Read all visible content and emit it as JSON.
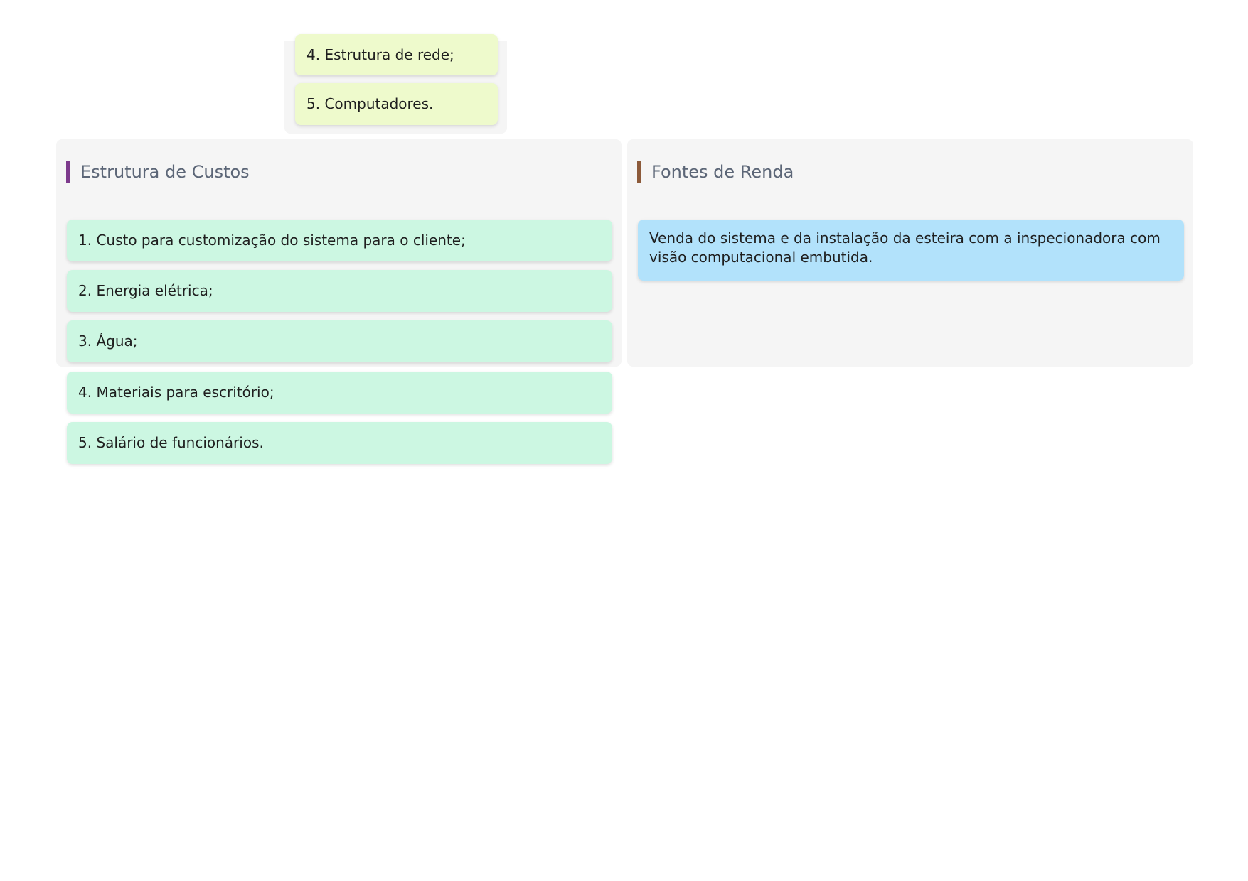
{
  "top_block": {
    "items": [
      "4. Estrutura de rede;",
      "5. Computadores."
    ]
  },
  "costs": {
    "title": "Estrutura de Custos",
    "accent_color": "#7d3a8c",
    "items": [
      "1. Custo para customização do sistema para o cliente;",
      "2. Energia elétrica;",
      "3. Água;",
      "4. Materiais para escritório;",
      "5. Salário de funcionários."
    ]
  },
  "revenue": {
    "title": "Fontes de Renda",
    "accent_color": "#8c5a3a",
    "items": [
      "Venda do sistema e da instalação da esteira com a inspecionadora com visão computacional embutida."
    ]
  },
  "colors": {
    "panel_background": "#f5f5f5",
    "yellow_card": "#eefacc",
    "green_card": "#ccf7e2",
    "blue_card": "#b2e2fb"
  }
}
